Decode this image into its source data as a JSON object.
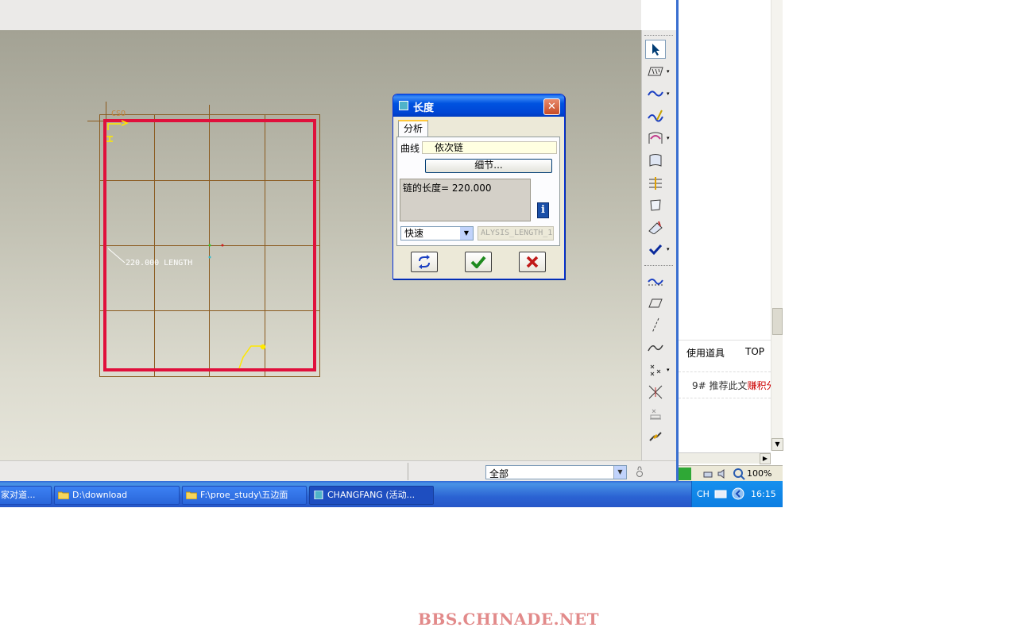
{
  "viewport": {
    "csys_label": "CSO",
    "dimension_label": "220.000 LENGTH"
  },
  "dialog": {
    "title": "长度",
    "tab_analysis": "分析",
    "curve_label": "曲线",
    "curve_value": "依次链",
    "details_button": "细节...",
    "result_text": "链的长度= 220.000",
    "mode_value": "快速",
    "param_name": "ALYSIS_LENGTH_1"
  },
  "statusbar": {
    "filter_value": "全部"
  },
  "browser": {
    "tab_tools": "使用道具",
    "tab_top": "TOP",
    "post_number": "9#",
    "post_text": "推荐此文",
    "post_highlight": "赚积分",
    "zoom": "100%"
  },
  "taskbar": {
    "items": [
      "家对道...",
      "D:\\download",
      "F:\\proe_study\\五边面",
      "CHANGFANG (活动..."
    ],
    "lang": "CH",
    "clock": "16:15"
  },
  "footer": {
    "watermark": "BBS.CHINADE.NET"
  },
  "colors": {
    "sketch_red": "#e0103c",
    "grid_brown": "#8a5a1e",
    "accent_blue": "#0053e0"
  }
}
